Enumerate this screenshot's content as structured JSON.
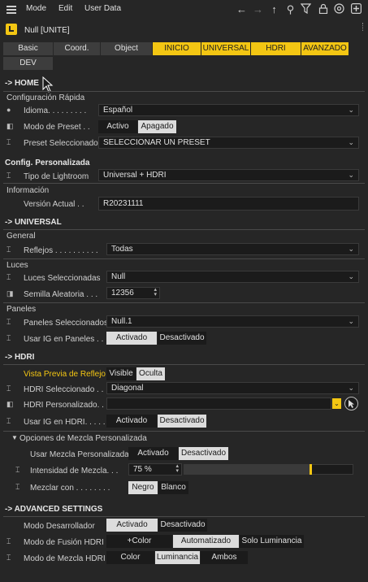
{
  "menubar": {
    "items": [
      "Mode",
      "Edit",
      "User Data"
    ],
    "icons": [
      "arrow-left-icon",
      "arrow-right-icon",
      "arrow-up-icon",
      "search-icon",
      "filter-icon",
      "lock-icon",
      "target-icon",
      "add-icon"
    ]
  },
  "title": "Null [UNITE]",
  "tabs": {
    "row1": [
      "Basic",
      "Coord.",
      "Object",
      "INICIO",
      "UNIVERSAL",
      "HDRI",
      "AVANZADO"
    ],
    "row2": [
      "DEV"
    ]
  },
  "home": {
    "header": "-> HOME",
    "quick": "Configuración Rápida",
    "idioma_label": "Idioma. . . . . . . . .",
    "idioma_value": "Español",
    "preset_mode_label": "Modo de Preset . .",
    "preset_mode_options": [
      "Activo",
      "Apagado"
    ],
    "preset_sel_label": "Preset Seleccionado",
    "preset_sel_value": "SELECCIONAR UN PRESET",
    "custom": "Config. Personalizada",
    "lightroom_label": "Tipo de Lightroom",
    "lightroom_value": "Universal + HDRI",
    "info": "Información",
    "version_label": "Versión Actual . .",
    "version_value": "R20231111"
  },
  "universal": {
    "header": "-> UNIVERSAL",
    "general": "General",
    "reflejos_label": "Reflejos . . . . . . . . . .",
    "reflejos_value": "Todas",
    "luces": "Luces",
    "luces_sel_label": "Luces Seleccionadas",
    "luces_sel_value": "Null",
    "semilla_label": "Semilla Aleatoria . . .",
    "semilla_value": "12356",
    "paneles": "Paneles",
    "paneles_sel_label": "Paneles Seleccionados",
    "paneles_sel_value": "Null.1",
    "ig_paneles_label": "Usar IG en Paneles . .",
    "ig_options": [
      "Activado",
      "Desactivado"
    ]
  },
  "hdri": {
    "header": "-> HDRI",
    "preview_label": "Vista Previa de Reflejo",
    "preview_options": [
      "Visible",
      "Oculta"
    ],
    "sel_label": "HDRI Seleccionado . . .",
    "sel_value": "Diagonal",
    "custom_label": "HDRI Personalizado. . .",
    "custom_value": "",
    "ig_label": "Usar IG en HDRI. . . . .",
    "ig_options": [
      "Activado",
      "Desactivado"
    ],
    "mix_group": "Opciones de Mezcla Personalizada",
    "mix_custom_label": "Usar Mezcla Personalizada",
    "mix_custom_options": [
      "Activado",
      "Desactivado"
    ],
    "intensity_label": "Intensidad de Mezcla. . .",
    "intensity_value": "75 %",
    "intensity_fraction": 0.75,
    "mix_with_label": "Mezclar con . . . . . . . .",
    "mix_with_options": [
      "Negro",
      "Blanco"
    ]
  },
  "advanced": {
    "header": "-> ADVANCED SETTINGS",
    "dev_mode_label": "Modo Desarrollador",
    "dev_mode_options": [
      "Activado",
      "Desactivado"
    ],
    "fusion_label": "Modo de Fusión HDRI",
    "fusion_options": [
      "+Color",
      "Automatizado",
      "Solo Luminancia"
    ],
    "mezcla_label": "Modo de Mezcla HDRI",
    "mezcla_options": [
      "Color",
      "Luminancia",
      "Ambos"
    ]
  },
  "colors": {
    "accent": "#f3c613",
    "background": "#262626",
    "field": "#1b1b1b"
  }
}
